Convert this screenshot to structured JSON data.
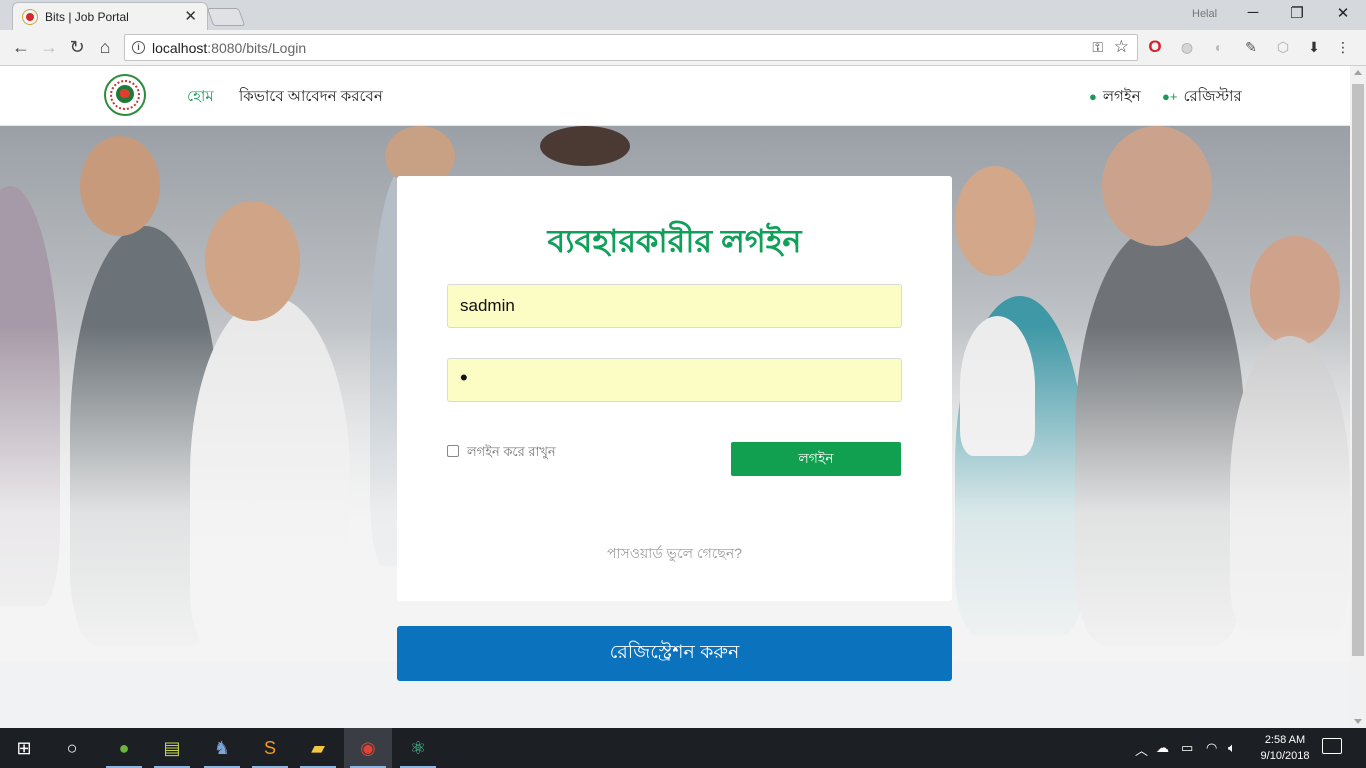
{
  "browser": {
    "tab_title": "Bits | Job Portal",
    "tab_close": "✕",
    "profile_name": "Helal",
    "url_host": "localhost",
    "url_path": ":8080/bits/Login",
    "window_controls": {
      "minimize": "─",
      "maximize": "❐",
      "close": "✕"
    }
  },
  "site": {
    "nav": {
      "home": "হোম",
      "how_to_apply": "কিভাবে আবেদন করবেন",
      "login": "লগইন",
      "register": "রেজিস্টার"
    },
    "login_card": {
      "heading": "ব্যবহারকারীর লগইন",
      "username_value": "sadmin",
      "password_mask": "•",
      "remember_label": "লগইন করে রাখুন",
      "login_button": "লগইন",
      "forgot_password": "পাসওয়ার্ড ভুলে গেছেন?"
    },
    "register_button": "রেজিস্ট্রেশন করুন"
  },
  "taskbar": {
    "time": "2:58 AM",
    "date": "9/10/2018"
  },
  "colors": {
    "brand_green": "#10a05a",
    "register_blue": "#0b72bd",
    "input_fill": "#fbfdc4"
  }
}
